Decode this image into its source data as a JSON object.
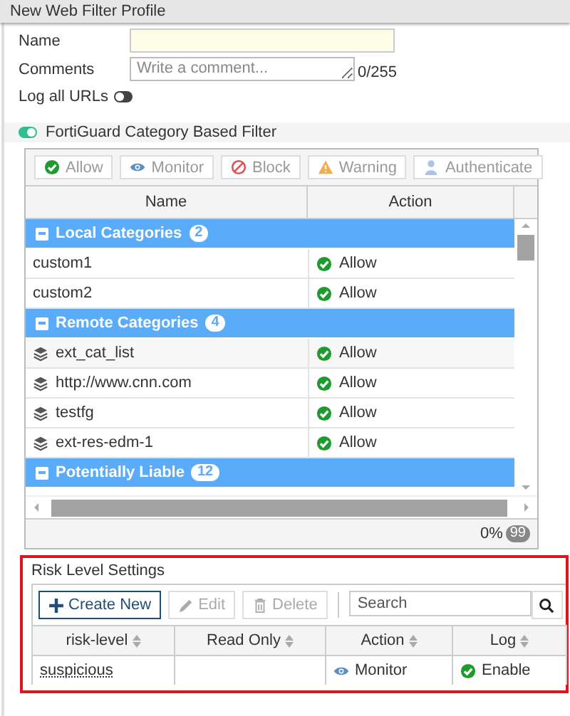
{
  "window": {
    "title": "New Web Filter Profile"
  },
  "form": {
    "name": {
      "label": "Name"
    },
    "comments": {
      "label": "Comments",
      "placeholder": "Write a comment...",
      "counter": "0/255"
    },
    "log_all_urls": {
      "label": "Log all URLs",
      "on": false
    }
  },
  "fortiguard": {
    "label": "FortiGuard Category Based Filter",
    "on": true
  },
  "category_toolbar": [
    {
      "label": "Allow",
      "kind": "allow",
      "disabled": true
    },
    {
      "label": "Monitor",
      "kind": "monitor",
      "disabled": true
    },
    {
      "label": "Block",
      "kind": "block",
      "disabled": true
    },
    {
      "label": "Warning",
      "kind": "warning",
      "disabled": true
    },
    {
      "label": "Authenticate",
      "kind": "authenticate",
      "disabled": true
    }
  ],
  "category_table": {
    "columns": [
      "Name",
      "Action"
    ],
    "groups": [
      {
        "name": "Local Categories",
        "count": "2",
        "expanded": true,
        "rows": [
          {
            "name": "custom1",
            "kind": "local",
            "action": {
              "label": "Allow",
              "kind": "allow"
            }
          },
          {
            "name": "custom2",
            "kind": "local",
            "action": {
              "label": "Allow",
              "kind": "allow"
            }
          }
        ]
      },
      {
        "name": "Remote Categories",
        "count": "4",
        "expanded": true,
        "rows": [
          {
            "name": "ext_cat_list",
            "kind": "remote",
            "action": {
              "label": "Allow",
              "kind": "allow"
            }
          },
          {
            "name": "http://www.cnn.com",
            "kind": "remote",
            "action": {
              "label": "Allow",
              "kind": "allow"
            }
          },
          {
            "name": "testfg",
            "kind": "remote",
            "action": {
              "label": "Allow",
              "kind": "allow"
            }
          },
          {
            "name": "ext-res-edm-1",
            "kind": "remote",
            "action": {
              "label": "Allow",
              "kind": "allow"
            }
          }
        ]
      },
      {
        "name": "Potentially Liable",
        "count": "12",
        "expanded": true
      }
    ],
    "footer": {
      "percent": "0%",
      "count": "99"
    }
  },
  "risk_level": {
    "title": "Risk Level Settings",
    "toolbar": [
      {
        "label": "Create New",
        "kind": "create",
        "disabled": false
      },
      {
        "label": "Edit",
        "kind": "edit",
        "disabled": true
      },
      {
        "label": "Delete",
        "kind": "delete",
        "disabled": true
      }
    ],
    "search": {
      "placeholder": "Search"
    },
    "columns": [
      "risk-level",
      "Read Only",
      "Action",
      "Log"
    ],
    "rows": [
      {
        "risk_level": "suspicious",
        "action": {
          "label": "Monitor",
          "kind": "monitor"
        },
        "log": {
          "label": "Enable",
          "kind": "enable"
        }
      }
    ]
  }
}
